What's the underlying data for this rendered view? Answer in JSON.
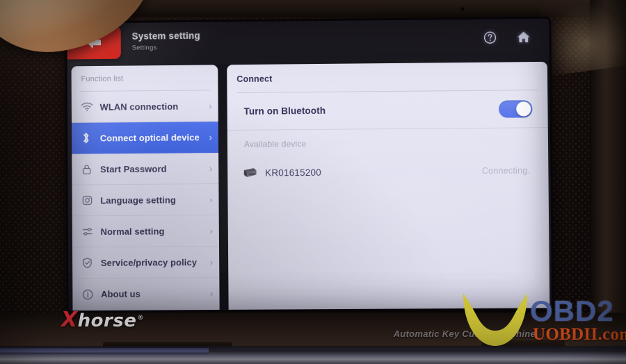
{
  "titlebar": {
    "back_icon": "arrow-left-icon",
    "title": "System setting",
    "subtitle": "Settings",
    "help_icon": "help-circle-icon",
    "home_icon": "home-icon"
  },
  "sidebar": {
    "header": "Function list",
    "items": [
      {
        "label": "WLAN connection",
        "icon": "wifi-icon",
        "chevron": "›",
        "active": false
      },
      {
        "label": "Connect optical device",
        "icon": "bluetooth-icon",
        "chevron": "›",
        "active": true
      },
      {
        "label": "Start Password",
        "icon": "lock-icon",
        "chevron": "›",
        "active": false
      },
      {
        "label": "Language setting",
        "icon": "language-icon",
        "chevron": "›",
        "active": false
      },
      {
        "label": "Normal setting",
        "icon": "sliders-icon",
        "chevron": "›",
        "active": false
      },
      {
        "label": "Service/privacy policy",
        "icon": "shield-icon",
        "chevron": "›",
        "active": false
      },
      {
        "label": "About us",
        "icon": "info-icon",
        "chevron": "›",
        "active": false
      }
    ]
  },
  "content": {
    "header": "Connect",
    "bluetooth_row": {
      "label": "Turn on Bluetooth",
      "toggle_state": "on"
    },
    "available_header": "Available device",
    "devices": [
      {
        "icon": "device-icon",
        "name": "KR01615200",
        "status": "Connecting."
      }
    ]
  },
  "device_chassis": {
    "brand_x": "X",
    "brand_rest": "horse",
    "brand_registered": "®",
    "tagline": "Automatic Key Cutting Machine"
  },
  "watermark": {
    "logo_text": "OBD2",
    "site_text": "UOBDII.com",
    "moon_icon": "crescent-icon"
  },
  "colors": {
    "accent_blue": "#4468e6",
    "back_red": "#d81c14",
    "panel_bg": "#e1e1f1",
    "text_dark": "#33335a",
    "muted": "#a3a3b8",
    "watermark_orange": "#e2541b",
    "watermark_blue": "#4a5f9e"
  }
}
